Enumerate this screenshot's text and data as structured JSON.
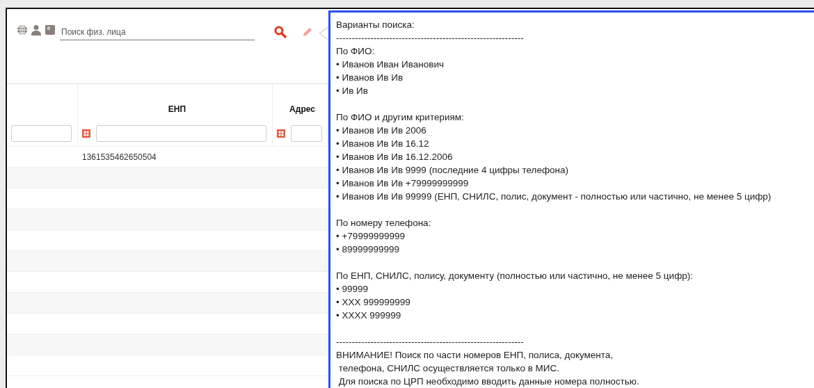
{
  "toolbar": {
    "search": {
      "placeholder": "Поиск физ. лица"
    }
  },
  "table": {
    "columns": [
      {
        "filter_icon": false
      },
      {
        "label": "ЕНП",
        "filter_icon": true
      },
      {
        "label": "Адрес",
        "filter_icon": true
      }
    ],
    "rows": [
      [
        "",
        "1361535462650504",
        ""
      ],
      [
        "",
        "",
        ""
      ],
      [
        "",
        "",
        ""
      ],
      [
        "",
        "",
        ""
      ],
      [
        "",
        "",
        ""
      ],
      [
        "",
        "",
        ""
      ],
      [
        "",
        "",
        ""
      ],
      [
        "",
        "",
        ""
      ],
      [
        "",
        "",
        ""
      ],
      [
        "",
        "",
        ""
      ],
      [
        "",
        "",
        ""
      ]
    ]
  },
  "tooltip": {
    "sections": [
      {
        "lines": [
          "Варианты поиска:",
          "------------------------------------------------------------"
        ]
      },
      {
        "lines": [
          "По ФИО:",
          "• Иванов Иван Иванович",
          "• Иванов Ив Ив",
          "• Ив Ив"
        ]
      },
      {
        "lines": [
          "По ФИО и другим критериям:",
          "• Иванов Ив Ив 2006",
          "• Иванов Ив Ив 16.12",
          "• Иванов Ив Ив 16.12.2006",
          "• Иванов Ив Ив 9999 (последние 4 цифры телефона)",
          "• Иванов Ив Ив +79999999999",
          "• Иванов Ив Ив 99999 (ЕНП, СНИЛС, полис, документ - полностью или частично, не менее 5 цифр)"
        ]
      },
      {
        "lines": [
          "По номеру телефона:",
          "• +79999999999",
          "• 89999999999"
        ]
      },
      {
        "lines": [
          "По ЕНП, СНИЛС, полису, документу (полностью или частично, не менее 5 цифр):",
          "• 99999",
          "• XXX 999999999",
          "• XXXX 999999"
        ]
      },
      {
        "lines": [
          "------------------------------------------------------------",
          "ВНИМАНИЕ! Поиск по части номеров ЕНП, полиса, документа,",
          " телефона, СНИЛС осуществляется только в МИС.",
          " Для поиска по ЦРП необходимо вводить данные номера полностью."
        ]
      }
    ]
  }
}
